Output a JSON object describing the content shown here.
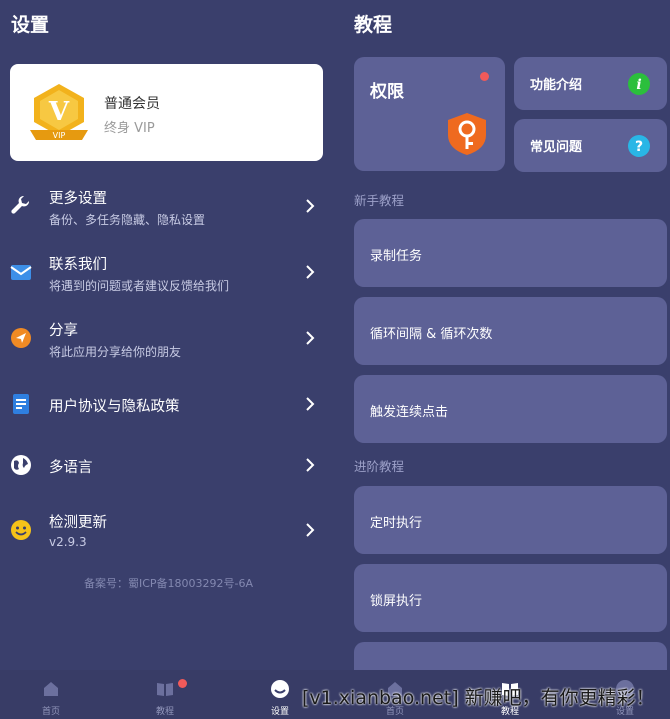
{
  "left": {
    "title": "设置",
    "vip": {
      "name": "普通会员",
      "sub": "终身 VIP",
      "badge_text": "VIP"
    },
    "rows": [
      {
        "title": "更多设置",
        "sub": "备份、多任务隐藏、隐私设置",
        "icon": "wrench-icon"
      },
      {
        "title": "联系我们",
        "sub": "将遇到的问题或者建议反馈给我们",
        "icon": "mail-icon"
      },
      {
        "title": "分享",
        "sub": "将此应用分享给你的朋友",
        "icon": "share-icon"
      },
      {
        "title": "用户协议与隐私政策",
        "sub": "",
        "icon": "document-icon"
      },
      {
        "title": "多语言",
        "sub": "",
        "icon": "globe-icon"
      },
      {
        "title": "检测更新",
        "sub": "v2.9.3",
        "icon": "smiley-icon"
      }
    ],
    "beian": "备案号：蜀ICP备18003292号-6A"
  },
  "right": {
    "title": "教程",
    "permission": {
      "label": "权限"
    },
    "feature": {
      "label": "功能介绍",
      "icon_char": "i"
    },
    "faq": {
      "label": "常见问题",
      "icon_char": "?"
    },
    "beginner_label": "新手教程",
    "beginner": [
      "录制任务",
      "循环间隔 & 循环次数",
      "触发连续点击"
    ],
    "advanced_label": "进阶教程",
    "advanced": [
      "定时执行",
      "锁屏执行"
    ]
  },
  "nav": {
    "left": [
      "首页",
      "教程",
      "设置"
    ],
    "right": [
      "首页",
      "教程",
      "设置"
    ]
  },
  "watermark": "[v1.xianbao.net] 新赚吧，有你更精彩！",
  "colors": {
    "bg": "#3a3f6c",
    "card": "#5d6196",
    "accent_orange": "#ef6a1f",
    "badge_gold": "#f2b21c",
    "dot_red": "#f05a5a",
    "green": "#2bbf3c",
    "cyan": "#29b6e6"
  }
}
